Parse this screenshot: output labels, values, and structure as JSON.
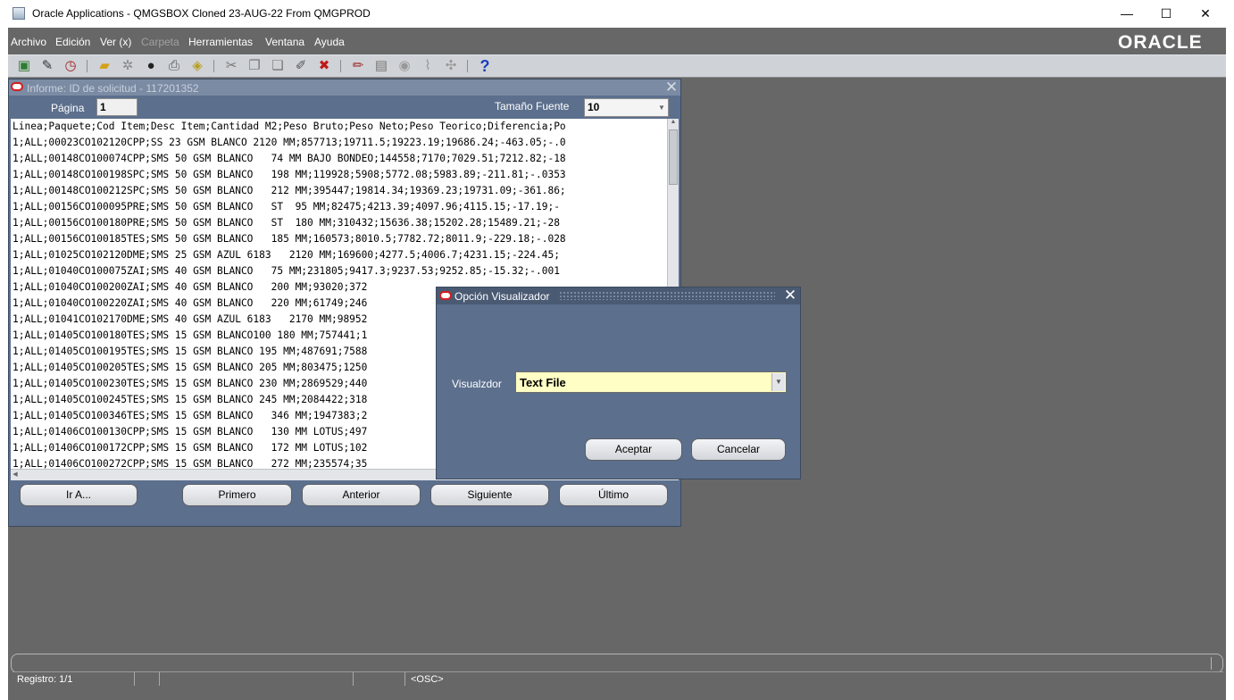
{
  "window": {
    "title": "Oracle Applications - QMGSBOX Cloned 23-AUG-22 From QMGPROD",
    "minimize": "—",
    "maximize": "☐",
    "close": "✕"
  },
  "menu": {
    "items": [
      "Archivo",
      "Edición",
      "Ver (x)",
      "Carpeta",
      "Herramientas",
      "Ventana",
      "Ayuda"
    ],
    "brand": "ORACLE"
  },
  "toolbar": {
    "icons": [
      "save-new-icon",
      "navigator-icon",
      "clock-icon",
      "folder-icon",
      "gear-icon",
      "binoculars-icon",
      "print-icon",
      "zoom-icon",
      "cut-icon",
      "copy-icon",
      "paste-icon",
      "clear-record-icon",
      "delete-icon",
      "edit-field-icon",
      "attachments-icon",
      "translation-icon",
      "paperclip-icon",
      "tools-icon",
      "help-icon"
    ],
    "help_glyph": "?"
  },
  "report": {
    "title": "Informe: ID de solicitud - 117201352",
    "page_label": "Página",
    "page_value": "1",
    "font_size_label": "Tamaño Fuente",
    "font_size_value": "10",
    "lines": [
      "Linea;Paquete;Cod Item;Desc Item;Cantidad M2;Peso Bruto;Peso Neto;Peso Teorico;Diferencia;Po",
      "1;ALL;00023CO102120CPP;SS 23 GSM BLANCO 2120 MM;857713;19711.5;19223.19;19686.24;-463.05;-.0",
      "1;ALL;00148CO100074CPP;SMS 50 GSM BLANCO   74 MM BAJO BONDEO;144558;7170;7029.51;7212.82;-18",
      "1;ALL;00148CO100198SPC;SMS 50 GSM BLANCO   198 MM;119928;5908;5772.08;5983.89;-211.81;-.0353",
      "1;ALL;00148CO100212SPC;SMS 50 GSM BLANCO   212 MM;395447;19814.34;19369.23;19731.09;-361.86;",
      "1;ALL;00156CO100095PRE;SMS 50 GSM BLANCO   ST  95 MM;82475;4213.39;4097.96;4115.15;-17.19;-",
      "1;ALL;00156CO100180PRE;SMS 50 GSM BLANCO   ST  180 MM;310432;15636.38;15202.28;15489.21;-28",
      "1;ALL;00156CO100185TES;SMS 50 GSM BLANCO   185 MM;160573;8010.5;7782.72;8011.9;-229.18;-.028",
      "1;ALL;01025CO102120DME;SMS 25 GSM AZUL 6183   2120 MM;169600;4277.5;4006.7;4231.15;-224.45;",
      "1;ALL;01040CO100075ZAI;SMS 40 GSM BLANCO   75 MM;231805;9417.3;9237.53;9252.85;-15.32;-.001",
      "1;ALL;01040CO100200ZAI;SMS 40 GSM BLANCO   200 MM;93020;372",
      "1;ALL;01040CO100220ZAI;SMS 40 GSM BLANCO   220 MM;61749;246",
      "1;ALL;01041CO102170DME;SMS 40 GSM AZUL 6183   2170 MM;98952",
      "1;ALL;01405CO100180TES;SMS 15 GSM BLANCO100 180 MM;757441;1",
      "1;ALL;01405CO100195TES;SMS 15 GSM BLANCO 195 MM;487691;7588",
      "1;ALL;01405CO100205TES;SMS 15 GSM BLANCO 205 MM;803475;1250",
      "1;ALL;01405CO100230TES;SMS 15 GSM BLANCO 230 MM;2869529;440",
      "1;ALL;01405CO100245TES;SMS 15 GSM BLANCO 245 MM;2084422;318",
      "1;ALL;01405CO100346TES;SMS 15 GSM BLANCO   346 MM;1947383;2",
      "1;ALL;01406CO100130CPP;SMS 15 GSM BLANCO   130 MM LOTUS;497",
      "1;ALL;01406CO100172CPP;SMS 15 GSM BLANCO   172 MM LOTUS;102",
      "1;ALL;01406CO100272CPP;SMS 15 GSM BLANCO   272 MM;235574;35"
    ],
    "buttons": {
      "goto": "Ir A...",
      "first": "Primero",
      "previous": "Anterior",
      "next": "Siguiente",
      "last": "Último"
    }
  },
  "dialog": {
    "title": "Opción Visualizador",
    "viewer_label": "Visualzdor",
    "viewer_value": "Text File",
    "accept": "Aceptar",
    "cancel": "Cancelar"
  },
  "status": {
    "record": "Registro: 1/1",
    "osc": "<OSC>"
  }
}
